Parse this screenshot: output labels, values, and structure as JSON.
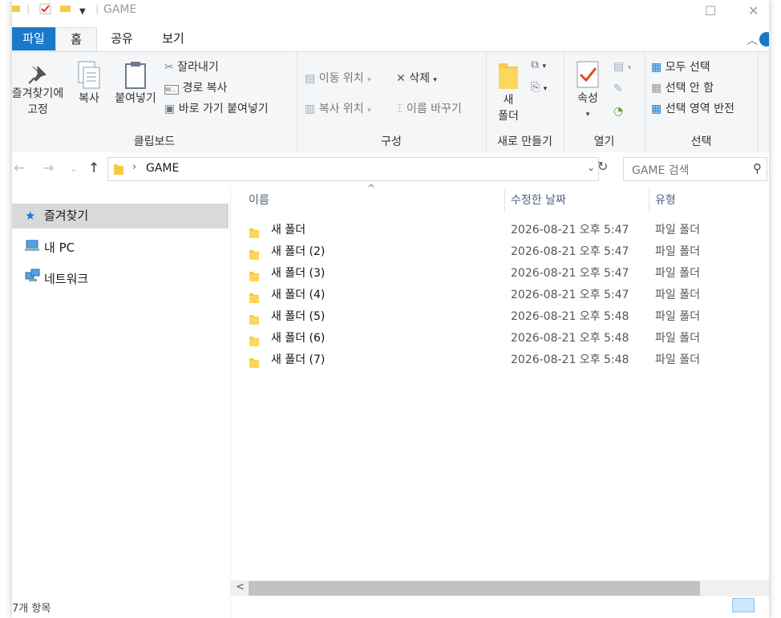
{
  "window": {
    "title": "GAME"
  },
  "tabs": {
    "file": "파일",
    "home": "홈",
    "share": "공유",
    "view": "보기"
  },
  "ribbon": {
    "clipboard": {
      "pin_label_1": "즐겨찾기에",
      "pin_label_2": "고정",
      "copy": "복사",
      "paste": "붙여넣기",
      "cut": "잘라내기",
      "copy_path": "경로 복사",
      "paste_shortcut": "바로 가기 붙여넣기",
      "group": "클립보드"
    },
    "organize": {
      "move_to": "이동 위치",
      "delete": "삭제",
      "copy_to": "복사 위치",
      "rename": "이름 바꾸기",
      "group": "구성"
    },
    "new": {
      "new_folder_1": "새",
      "new_folder_2": "폴더",
      "group": "새로 만들기"
    },
    "open": {
      "properties": "속성",
      "group": "열기"
    },
    "select": {
      "select_all": "모두 선택",
      "select_none": "선택 안 함",
      "invert": "선택 영역 반전",
      "group": "선택"
    }
  },
  "address": {
    "crumb": "GAME"
  },
  "search": {
    "placeholder": "GAME 검색"
  },
  "nav": {
    "items": [
      {
        "label": "즐겨찾기",
        "icon": "star-icon",
        "selected": true
      },
      {
        "label": "내 PC",
        "icon": "computer-icon",
        "selected": false
      },
      {
        "label": "네트워크",
        "icon": "network-icon",
        "selected": false
      }
    ]
  },
  "columns": {
    "name": "이름",
    "date": "수정한 날짜",
    "type": "유형"
  },
  "files": [
    {
      "name": "새 폴더",
      "date": "2026-08-21 오후 5:47",
      "type": "파일 폴더"
    },
    {
      "name": "새 폴더 (2)",
      "date": "2026-08-21 오후 5:47",
      "type": "파일 폴더"
    },
    {
      "name": "새 폴더 (3)",
      "date": "2026-08-21 오후 5:47",
      "type": "파일 폴더"
    },
    {
      "name": "새 폴더 (4)",
      "date": "2026-08-21 오후 5:47",
      "type": "파일 폴더"
    },
    {
      "name": "새 폴더 (5)",
      "date": "2026-08-21 오후 5:48",
      "type": "파일 폴더"
    },
    {
      "name": "새 폴더 (6)",
      "date": "2026-08-21 오후 5:48",
      "type": "파일 폴더"
    },
    {
      "name": "새 폴더 (7)",
      "date": "2026-08-21 오후 5:48",
      "type": "파일 폴더"
    }
  ],
  "status": {
    "count": "7개 항목"
  },
  "colors": {
    "accent": "#1979ca",
    "folder": "#f7c948",
    "selected_nav": "#d9d9d9"
  }
}
